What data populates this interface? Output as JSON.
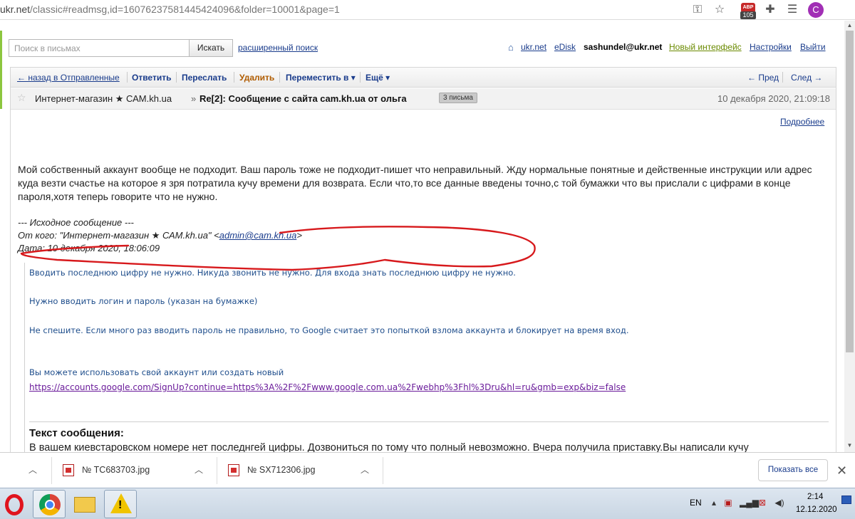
{
  "browser": {
    "url_main": "ukr.net",
    "url_rest": "/classic#readmsg,id=16076237581445424096&folder=10001&page=1",
    "adblock_count": "105",
    "profile_letter": "C"
  },
  "header": {
    "search_placeholder": "Поиск в письмах",
    "search_button": "Искать",
    "advanced_search": "расширенный поиск",
    "links": {
      "home": "⌂",
      "ukr": "ukr.net",
      "edisk": "eDisk",
      "user": "sashundel@ukr.net",
      "new_interface": "Новый интерфейс",
      "settings": "Настройки",
      "exit": "Выйти"
    }
  },
  "toolbar": {
    "back": "← назад в Отправленные",
    "reply": "Ответить",
    "forward": "Переслать",
    "delete": "Удалить",
    "move": "Переместить в ▾",
    "more": "Ещё ▾",
    "prev": "← Пред",
    "next": "След →"
  },
  "message": {
    "sender": "Интернет-магазин ★ САМ.kh.ua",
    "arrow": "»",
    "subject": "Re[2]: Сообщение с сайта cam.kh.ua от ольга",
    "thread_badge": "3 письма",
    "date": "10 декабря 2020, 21:09:18",
    "details": "Подробнее",
    "body": "Мой собственный аккаунт вообще не подходит. Ваш пароль тоже не подходит-пишет что неправильный. Жду нормальные понятные и действенные инструкции или адрес куда везти счастье на которое я зря потратила кучу времени для возврата. Если что,то все данные введены точно,с той бумажки что вы прислали с цифрами в конце пароля,хотя теперь говорите что не нужно.",
    "quote_header": "--- Исходное сообщение ---",
    "quote_from_label": "От кого: \"Интернет-магазин ★ САМ.kh.ua\" <",
    "quote_from_email": "admin@cam.kh.ua",
    "quote_from_end": ">",
    "quote_date": "Дата: 10 декабря 2020, 18:06:09",
    "quoted_lines": [
      "Вводить последнюю цифру не нужно. Никуда звонить не нужно. Для входа знать последнюю цифру не нужно.",
      "Нужно вводить логин и пароль (указан на бумажке)",
      "Не спешите. Если много раз вводить пароль не правильно, то Google считает это попыткой взлома аккаунта и блокирует на время вход.",
      "Вы можете использовать свой аккаунт или создать новый",
      "https://accounts.google.com/SignUp?continue=https%3A%2F%2Fwww.google.com.ua%2Fwebhp%3Fhl%3Dru&hl=ru&gmb=exp&biz=false"
    ],
    "text_heading": "Текст сообщения:",
    "text_body": "В вашем киевстаровском номере нет последнгей цифры. Дозвониться по тому что полный невозможно. Вчера получила приставку.Вы написали кучу паролей,мне нужно знать последжнгюю цифру,я уже задолбалась вводить капчу,система меня не пропускает,подтвердить ничего не могу. Или"
  },
  "downloads": {
    "items": [
      "№ TC683703.jpg",
      "№ SX712306.jpg"
    ],
    "show_all": "Показать все"
  },
  "taskbar": {
    "lang": "EN",
    "time": "2:14",
    "date": "12.12.2020"
  },
  "colors": {
    "link": "#1a3c8c",
    "scribble": "#d7191c",
    "accent_green": "#8cc63f"
  }
}
